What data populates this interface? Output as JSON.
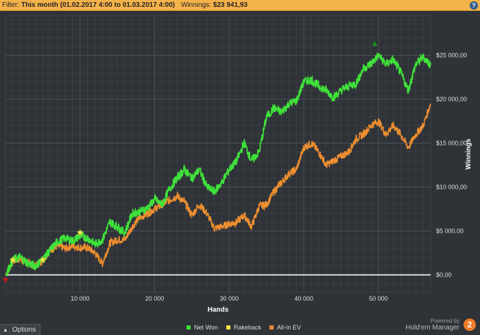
{
  "filter": {
    "prefix": "Filter:",
    "value": "This month (01.02.2017 4:00 to 01.03.2017 4:00)",
    "winnings_label": "Winnings:",
    "winnings_value": "$23 941,93"
  },
  "help_icon": "question-icon",
  "options_label": "Options",
  "powered": {
    "line1": "Powered by",
    "line2": "Hold'em Manager",
    "logo": "2"
  },
  "colors": {
    "net_won": "#3fe23a",
    "rakeback": "#f2e64a",
    "allin_ev": "#ef8f2f",
    "background": "#2f3338",
    "filter_bar": "#f4b24a"
  },
  "chart_data": {
    "type": "line",
    "xlabel": "Hands",
    "ylabel": "Winnings",
    "xlim": [
      0,
      57000
    ],
    "ylim": [
      -2000,
      29500
    ],
    "x_ticks": [
      10000,
      20000,
      30000,
      40000,
      50000
    ],
    "x_tick_labels": [
      "10 000",
      "20 000",
      "30 000",
      "40 000",
      "50 000"
    ],
    "y_ticks": [
      0,
      5000,
      10000,
      15000,
      20000,
      25000
    ],
    "y_tick_labels": [
      "$0,00",
      "$5 000,00",
      "$10 000,00",
      "$15 000,00",
      "$20 000,00",
      "$25 000,00"
    ],
    "grid": true,
    "legend_position": "bottom-center",
    "series": [
      {
        "name": "Net Won",
        "x": [
          0,
          1000,
          2000,
          3000,
          4000,
          5000,
          6000,
          7000,
          8000,
          9000,
          10000,
          11000,
          12000,
          13000,
          14000,
          15000,
          16000,
          17000,
          18000,
          19000,
          20000,
          21000,
          22000,
          23000,
          24000,
          25000,
          26000,
          27000,
          28000,
          29000,
          30000,
          31000,
          32000,
          33000,
          34000,
          35000,
          36000,
          37000,
          38000,
          39000,
          40000,
          41000,
          42000,
          43000,
          44000,
          45000,
          46000,
          47000,
          48000,
          49000,
          50000,
          51000,
          52000,
          53000,
          54000,
          55000,
          56000,
          57000
        ],
        "values": [
          0,
          1700,
          2000,
          1300,
          1000,
          1800,
          2800,
          3800,
          4200,
          3900,
          4400,
          4200,
          3500,
          4000,
          6000,
          5500,
          4800,
          7000,
          7200,
          7600,
          8600,
          8000,
          9800,
          11000,
          12000,
          11000,
          12000,
          10000,
          9500,
          10500,
          12000,
          13000,
          15000,
          13000,
          14000,
          18000,
          19000,
          18500,
          19500,
          19800,
          22000,
          22200,
          21500,
          21000,
          20200,
          21000,
          21500,
          21800,
          23500,
          24000,
          25000,
          24000,
          24500,
          23000,
          21000,
          24000,
          24800,
          23900
        ]
      },
      {
        "name": "All-In EV",
        "x": [
          0,
          1000,
          2000,
          3000,
          4000,
          5000,
          6000,
          7000,
          8000,
          9000,
          10000,
          11000,
          12000,
          13000,
          14000,
          15000,
          16000,
          17000,
          18000,
          19000,
          20000,
          21000,
          22000,
          23000,
          24000,
          25000,
          26000,
          27000,
          28000,
          29000,
          30000,
          31000,
          32000,
          33000,
          34000,
          35000,
          36000,
          37000,
          38000,
          39000,
          40000,
          41000,
          42000,
          43000,
          44000,
          45000,
          46000,
          47000,
          48000,
          49000,
          50000,
          51000,
          52000,
          53000,
          54000,
          55000,
          56000,
          57000
        ],
        "values": [
          0,
          1600,
          1800,
          1400,
          1000,
          1700,
          2800,
          3300,
          3000,
          3300,
          3100,
          3100,
          2500,
          1300,
          3600,
          4000,
          4000,
          5500,
          6500,
          7000,
          7500,
          8000,
          8500,
          9000,
          8300,
          6800,
          8000,
          7000,
          5300,
          5500,
          5800,
          6000,
          6800,
          5500,
          7800,
          8000,
          9500,
          10500,
          11500,
          12000,
          14500,
          15000,
          14000,
          12500,
          13000,
          13500,
          14000,
          15500,
          16000,
          17000,
          17500,
          16000,
          17000,
          16000,
          14500,
          16000,
          17000,
          19500
        ]
      },
      {
        "name": "Rakeback",
        "points": [
          {
            "x": 1000,
            "y": 1700
          },
          {
            "x": 5000,
            "y": 1700
          },
          {
            "x": 10000,
            "y": 4800
          }
        ]
      }
    ],
    "markers": [
      {
        "name": "max",
        "x": 49500,
        "y": 26300,
        "color": "#1a8f1a"
      },
      {
        "name": "min",
        "x": 0,
        "y": -600,
        "color": "#d01818"
      }
    ]
  }
}
